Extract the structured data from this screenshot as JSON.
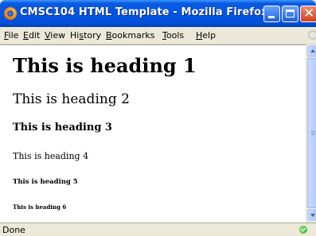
{
  "window": {
    "title": "CMSC104 HTML Template - Mozilla Firefox"
  },
  "menu": [
    {
      "pre": "",
      "ul": "F",
      "post": "ile"
    },
    {
      "pre": "",
      "ul": "E",
      "post": "dit"
    },
    {
      "pre": "",
      "ul": "V",
      "post": "iew"
    },
    {
      "pre": "Hi",
      "ul": "s",
      "post": "tory"
    },
    {
      "pre": "",
      "ul": "B",
      "post": "ookmarks"
    },
    {
      "pre": "",
      "ul": "T",
      "post": "ools"
    },
    {
      "pre": "",
      "ul": "H",
      "post": "elp"
    }
  ],
  "content": {
    "h1": "This is heading 1",
    "h2": "This is heading 2",
    "h3": "This is heading 3",
    "h4": "This is heading 4",
    "h5": "This is heading 5",
    "h6": "This is heading 6"
  },
  "status": {
    "text": "Done"
  },
  "colors": {
    "titlebar": "#0454e3",
    "close_button": "#d0401c",
    "chrome": "#ece9d8"
  },
  "icons": {
    "app": "firefox-icon",
    "status": "check-icon"
  }
}
